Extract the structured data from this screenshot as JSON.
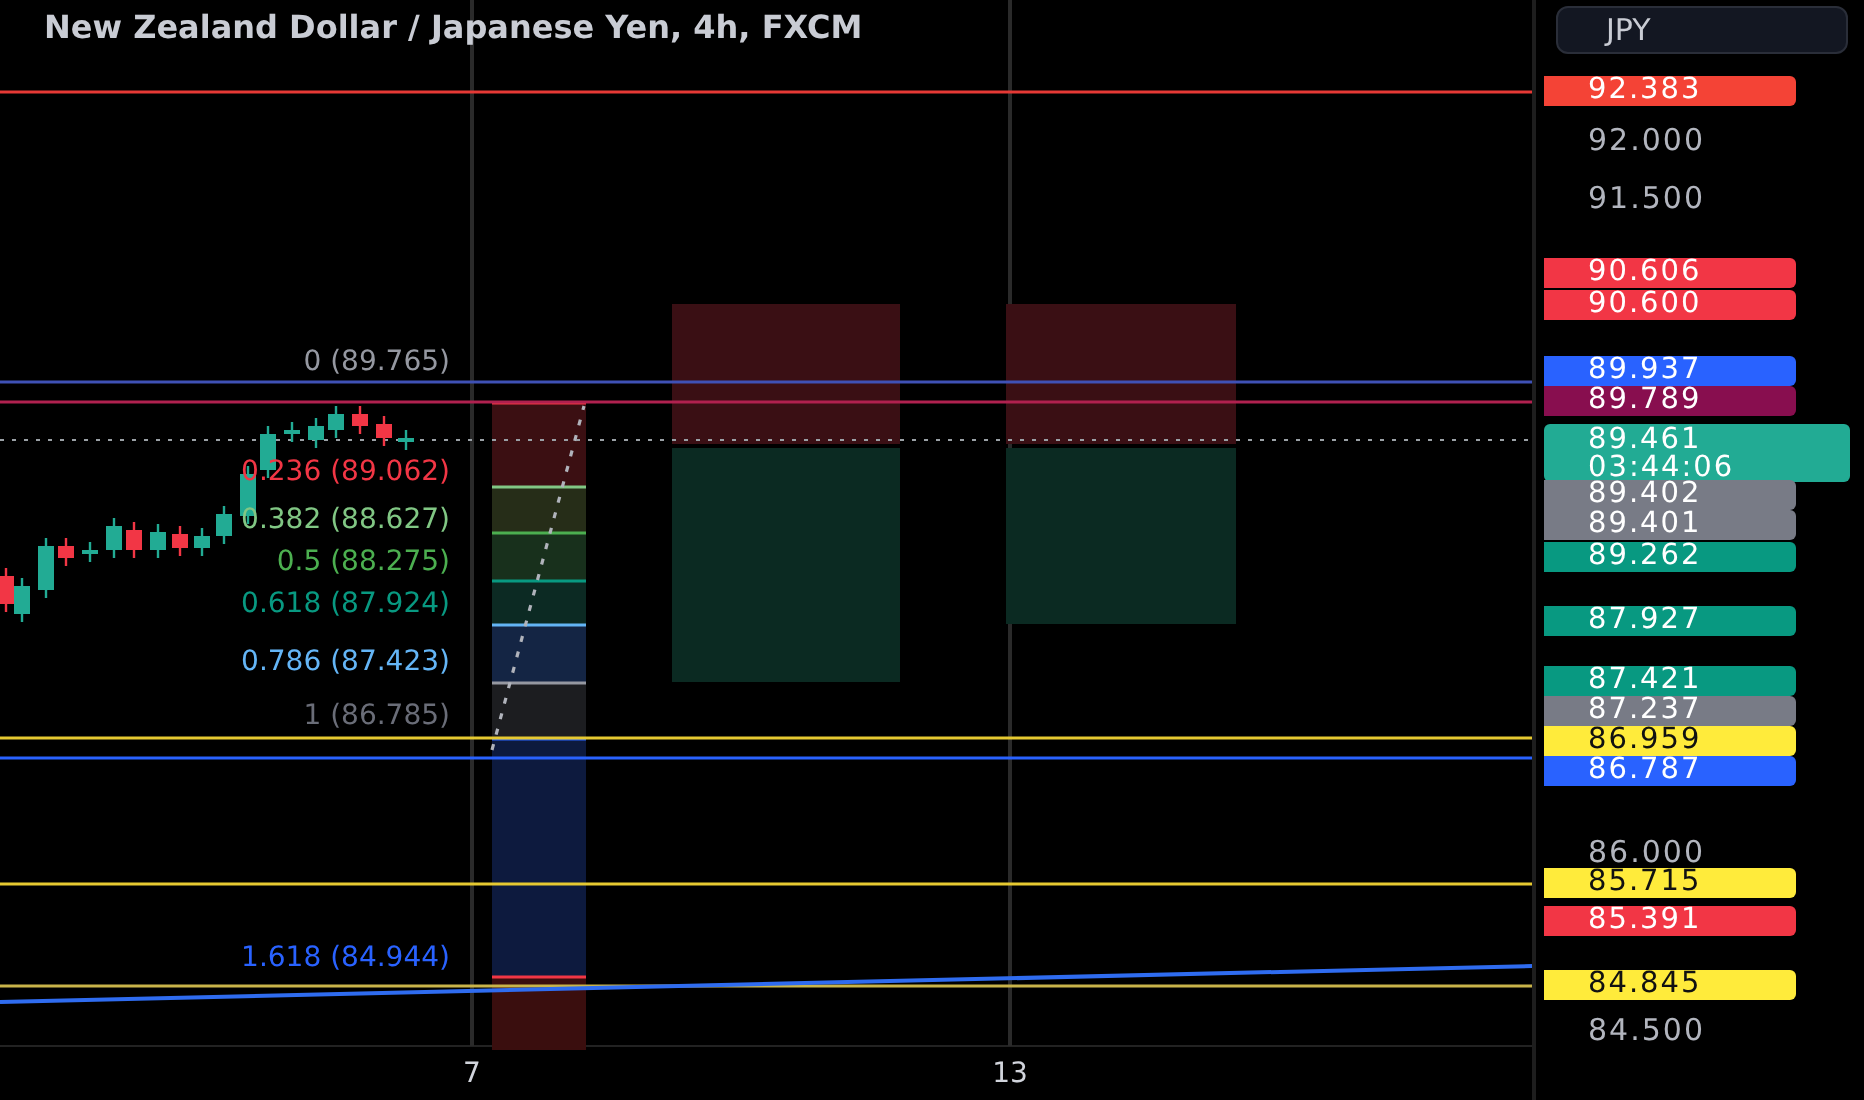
{
  "chart": {
    "title": "New Zealand Dollar / Japanese Yen, 4h, FXCM",
    "fib_labels": [
      {
        "text": "0 (89.765)",
        "color": "#9598a1"
      },
      {
        "text": "0.236 (89.062)",
        "color": "#f23645"
      },
      {
        "text": "0.382 (88.627)",
        "color": "#81c784"
      },
      {
        "text": "0.5 (88.275)",
        "color": "#4caf50"
      },
      {
        "text": "0.618 (87.924)",
        "color": "#089981"
      },
      {
        "text": "0.786 (87.423)",
        "color": "#64b5f6"
      },
      {
        "text": "1 (86.785)",
        "color": "#6a6d78"
      },
      {
        "text": "1.618 (84.944)",
        "color": "#2962ff"
      }
    ],
    "x_labels": [
      "7",
      "13"
    ]
  },
  "price_axis": {
    "currency_button": "JPY",
    "ticks": [
      "92.000",
      "91.500",
      "86.000",
      "84.500"
    ],
    "badges": [
      {
        "price": "92.383",
        "color": "#f44336"
      },
      {
        "price": "90.606",
        "color": "#f23645"
      },
      {
        "price": "90.600",
        "color": "#f23645"
      },
      {
        "price": "89.937",
        "color": "#2962ff"
      },
      {
        "price": "89.789",
        "color": "#880e4f"
      },
      {
        "price": "89.461",
        "time": "03:44:06",
        "color": "#22ab94"
      },
      {
        "price": "89.402",
        "color": "#787b86"
      },
      {
        "price": "89.401",
        "color": "#787b86"
      },
      {
        "price": "89.262",
        "color": "#089981"
      },
      {
        "price": "87.927",
        "color": "#089981"
      },
      {
        "price": "87.421",
        "color": "#089981"
      },
      {
        "price": "87.237",
        "color": "#787b86"
      },
      {
        "price": "86.959",
        "color": "#ffeb3b"
      },
      {
        "price": "86.787",
        "color": "#2962ff"
      },
      {
        "price": "85.715",
        "color": "#ffeb3b"
      },
      {
        "price": "85.391",
        "color": "#f23645"
      },
      {
        "price": "84.845",
        "color": "#ffeb3b"
      }
    ]
  }
}
